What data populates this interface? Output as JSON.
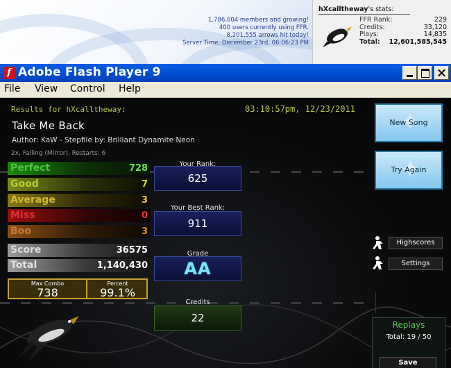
{
  "site": {
    "members_line": "1,786,004 members and growing!",
    "users_line": "400 users currently using FFR.",
    "arrows_line": "8,201,555 arrows hit today!",
    "server_time_line": "Server Time: December 23rd, 06:06:23 PM"
  },
  "user_stats": {
    "username": "hXcalltheway",
    "title_suffix": "'s stats:",
    "rows": [
      {
        "label": "FFR Rank:",
        "value": "229"
      },
      {
        "label": "Credits:",
        "value": "33,120"
      },
      {
        "label": "Plays:",
        "value": "14,835"
      },
      {
        "label": "Total:",
        "value": "12,601,585,545"
      }
    ]
  },
  "window": {
    "title": "Adobe Flash Player 9",
    "flash_icon": "f"
  },
  "menu": [
    "File",
    "View",
    "Control",
    "Help"
  ],
  "results": {
    "header": "Results for hXcalltheway:",
    "timestamp": "03:10:57pm, 12/23/2011",
    "song_title": "Take Me Back",
    "author_line": "Author: KaW   -   Stepfile by: Brilliant Dynamite Neon",
    "mods_line": "2x, Falling (Mirror), Restarts: 6",
    "judges": {
      "perfect": {
        "label": "Perfect",
        "value": "728"
      },
      "good": {
        "label": "Good",
        "value": "7"
      },
      "average": {
        "label": "Average",
        "value": "3"
      },
      "miss": {
        "label": "Miss",
        "value": "0"
      },
      "boo": {
        "label": "Boo",
        "value": "3"
      },
      "score": {
        "label": "Score",
        "value": "36575"
      },
      "total": {
        "label": "Total",
        "value": "1,140,430"
      }
    },
    "max_combo_label": "Max Combo",
    "max_combo": "738",
    "percent_label": "Percent",
    "percent": "99.1%",
    "your_rank_label": "Your Rank:",
    "your_rank": "625",
    "best_rank_label": "Your Best Rank:",
    "best_rank": "911",
    "grade_label": "Grade",
    "grade": "AA",
    "credits_label": "Credits",
    "credits": "22"
  },
  "buttons": {
    "new_song": "New Song",
    "try_again": "Try Again",
    "highscores": "Highscores",
    "settings": "Settings",
    "save": "Save"
  },
  "replays": {
    "title": "Replays",
    "total": "Total: 19 / 50"
  },
  "colors": {
    "titlebar": "#0052d6",
    "perfect": "#4ec43a",
    "good": "#b9cc2e",
    "average": "#d2b82e",
    "miss": "#e23030",
    "boo": "#cc7a30",
    "accent_text": "#b8c850",
    "button_blue": "#86c6ee"
  }
}
